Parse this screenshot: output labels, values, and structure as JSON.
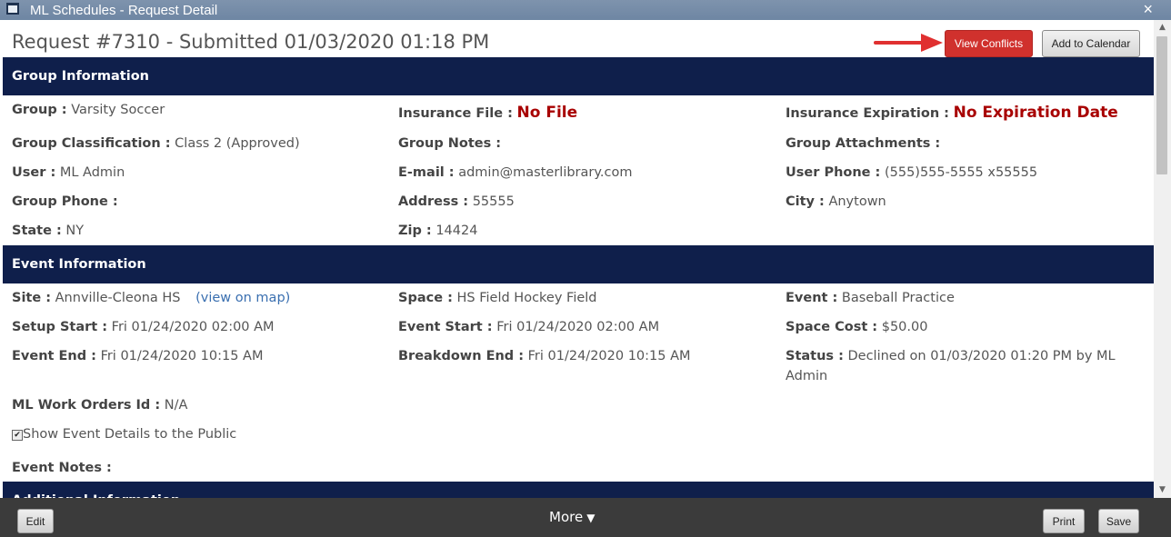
{
  "window": {
    "title": "ML Schedules - Request Detail",
    "close_label": "×"
  },
  "request": {
    "title": "Request #7310 - Submitted 01/03/2020 01:18 PM"
  },
  "buttons": {
    "view_conflicts": "View Conflicts",
    "add_to_calendar": "Add to Calendar"
  },
  "group_info": {
    "heading": "Group Information",
    "group": {
      "label": "Group :",
      "value": "Varsity Soccer"
    },
    "insurance_file": {
      "label": "Insurance File :",
      "value": "No File"
    },
    "insurance_expiration": {
      "label": "Insurance Expiration :",
      "value": "No Expiration Date"
    },
    "classification": {
      "label": "Group Classification :",
      "value": "Class 2 (Approved)"
    },
    "notes": {
      "label": "Group Notes :",
      "value": ""
    },
    "attachments": {
      "label": "Group Attachments :",
      "value": ""
    },
    "user": {
      "label": "User :",
      "value": "ML Admin"
    },
    "email": {
      "label": "E-mail :",
      "value": "admin@masterlibrary.com"
    },
    "user_phone": {
      "label": "User Phone :",
      "value": "(555)555-5555 x55555"
    },
    "group_phone": {
      "label": "Group Phone :",
      "value": ""
    },
    "address": {
      "label": "Address :",
      "value": "55555"
    },
    "city": {
      "label": "City :",
      "value": "Anytown"
    },
    "state": {
      "label": "State :",
      "value": "NY"
    },
    "zip": {
      "label": "Zip :",
      "value": "14424"
    }
  },
  "event_info": {
    "heading": "Event Information",
    "site": {
      "label": "Site :",
      "value": "Annville-Cleona HS",
      "link": "(view on map)"
    },
    "space": {
      "label": "Space :",
      "value": "HS Field Hockey Field"
    },
    "event": {
      "label": "Event :",
      "value": "Baseball Practice"
    },
    "setup_start": {
      "label": "Setup Start :",
      "value": "Fri 01/24/2020 02:00 AM"
    },
    "event_start": {
      "label": "Event Start :",
      "value": "Fri 01/24/2020 02:00 AM"
    },
    "space_cost": {
      "label": "Space Cost :",
      "value": "$50.00"
    },
    "event_end": {
      "label": "Event End :",
      "value": "Fri 01/24/2020 10:15 AM"
    },
    "breakdown_end": {
      "label": "Breakdown End :",
      "value": "Fri 01/24/2020 10:15 AM"
    },
    "status": {
      "label": "Status :",
      "value": "Declined on 01/03/2020 01:20 PM by ML Admin"
    },
    "work_orders": {
      "label": "ML Work Orders Id :",
      "value": "N/A"
    },
    "show_public": {
      "label": "Show Event Details to the Public",
      "checked": true
    },
    "event_notes": {
      "label": "Event Notes :",
      "value": ""
    }
  },
  "additional_info": {
    "heading": "Additional Information"
  },
  "footer": {
    "edit": "Edit",
    "more": "More",
    "print": "Print",
    "save": "Save"
  },
  "colors": {
    "section_bg": "#0f1f4b",
    "alert_red": "#a80000",
    "conflict_button": "#d0312d"
  }
}
